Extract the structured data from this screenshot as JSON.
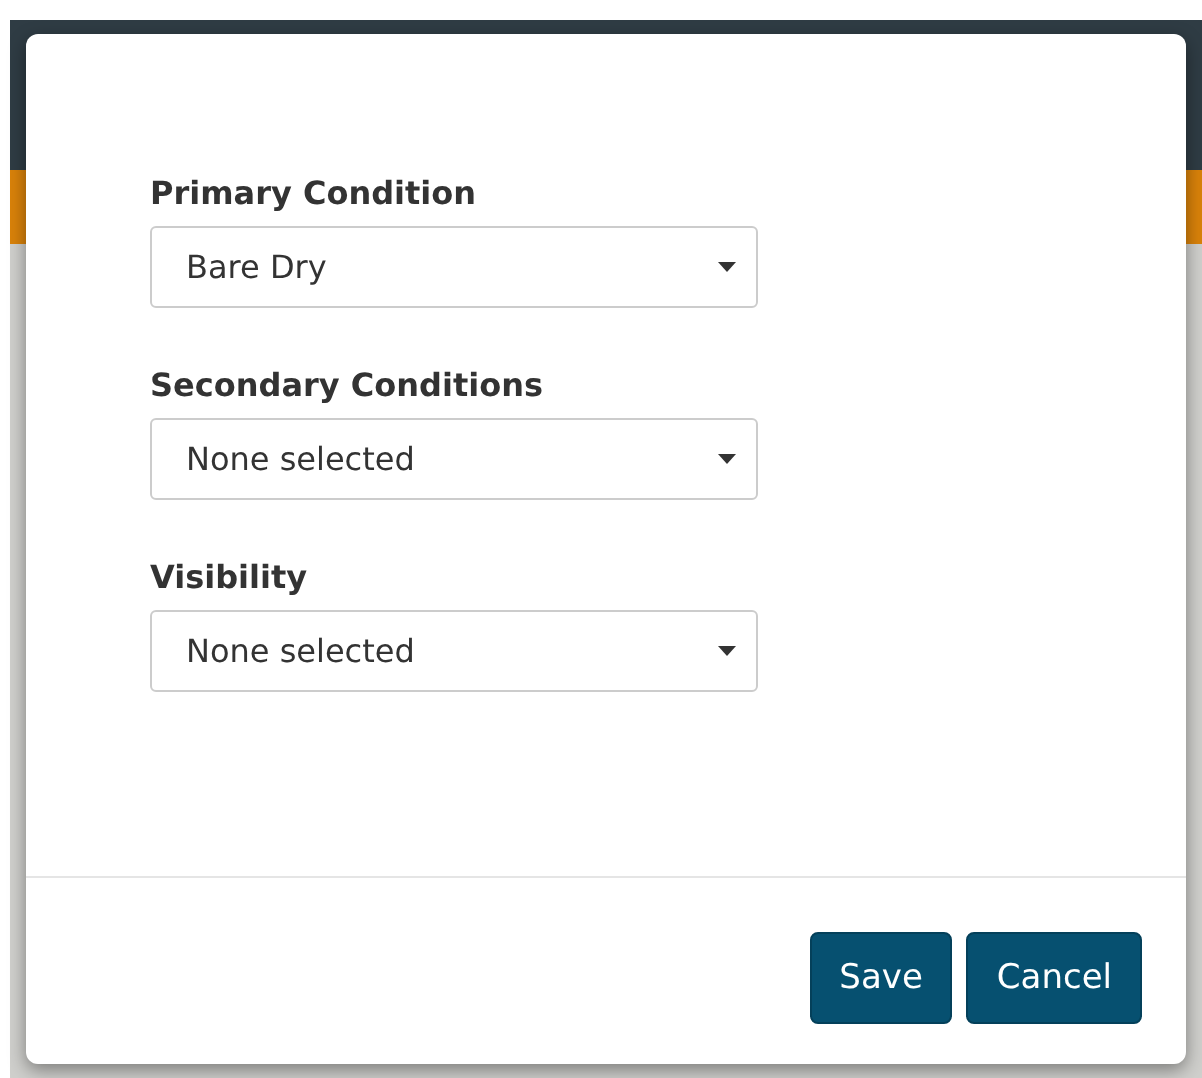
{
  "dialog": {
    "fields": [
      {
        "label": "Primary Condition",
        "value": "Bare Dry"
      },
      {
        "label": "Secondary Conditions",
        "value": "None selected"
      },
      {
        "label": "Visibility",
        "value": "None selected"
      }
    ],
    "buttons": [
      "Save",
      "Cancel"
    ]
  }
}
